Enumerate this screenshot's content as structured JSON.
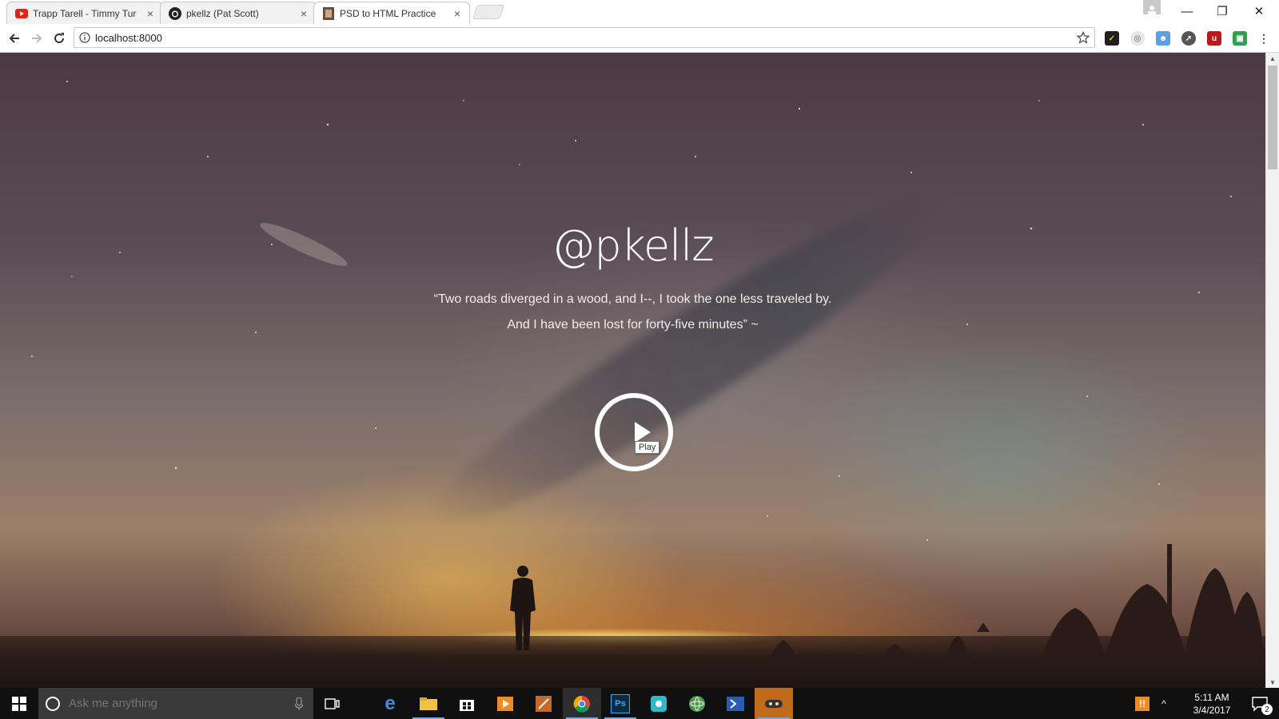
{
  "browser": {
    "tabs": [
      {
        "title": "Trapp Tarell - Timmy Tur",
        "favicon": "youtube-icon",
        "active": false
      },
      {
        "title": "pkellz (Pat Scott)",
        "favicon": "github-icon",
        "active": false
      },
      {
        "title": "PSD to HTML Practice",
        "favicon": "page-icon",
        "active": true
      }
    ],
    "close_glyph": "×",
    "url": "localhost:8000",
    "window_controls": {
      "minimize": "—",
      "restore": "❐",
      "close": "✕"
    },
    "extensions": [
      "norton-icon",
      "shield-icon",
      "honey-icon",
      "compass-icon",
      "ublock-icon",
      "screen-icon"
    ]
  },
  "page": {
    "title": "@pkellz",
    "quote_line1": "“Two roads diverged in a wood, and I--, I took the one less traveled by.",
    "quote_line2": "And I have been lost for forty-five minutes” ~",
    "play_tooltip": "Play"
  },
  "taskbar": {
    "search_placeholder": "Ask me anything",
    "apps": [
      "edge-icon",
      "file-explorer-icon",
      "store-icon",
      "media-player-icon",
      "paint-icon",
      "chrome-icon",
      "photoshop-icon",
      "app-icon",
      "atom-icon",
      "powershell-icon",
      "game-icon"
    ],
    "time": "5:11 AM",
    "date": "3/4/2017",
    "notification_count": "2"
  },
  "colors": {
    "accent_blue": "#1a73e8",
    "taskbar_bg": "#101010",
    "youtube_red": "#e62117"
  }
}
